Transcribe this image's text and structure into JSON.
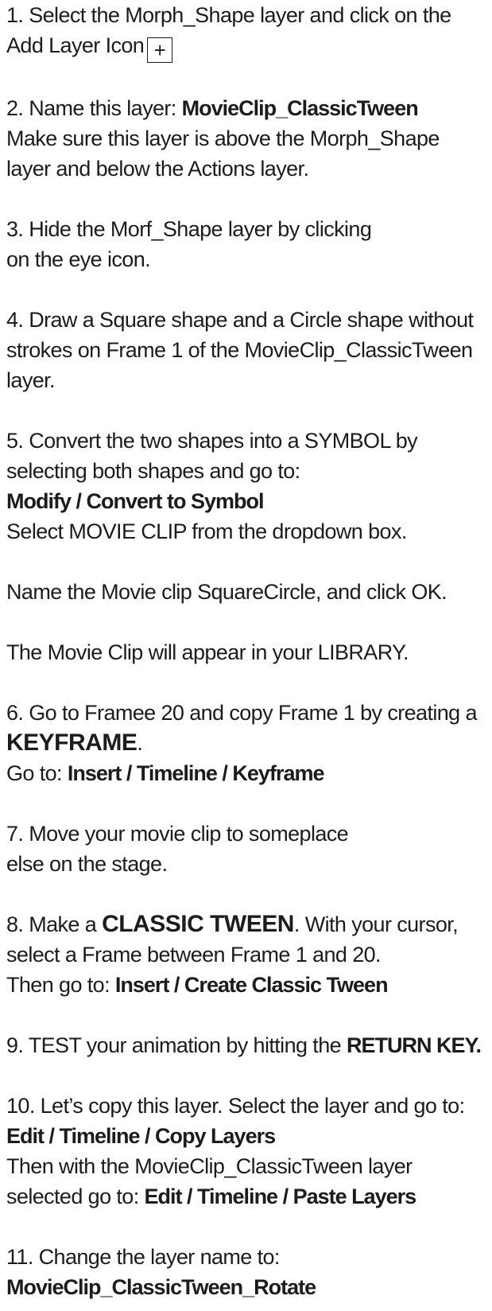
{
  "steps": [
    {
      "lines": [
        "1. Select the  Morph_Shape layer and click on the",
        "Add Layer Icon"
      ],
      "icon": {
        "name": "add-layer-icon",
        "glyph": "+"
      }
    },
    {
      "lines": [
        "2. Name this layer: ",
        "MovieClip_ClassicTween",
        "Make sure this layer is above the Morph_Shape",
        "layer and below the Actions layer."
      ]
    },
    {
      "lines": [
        "3. Hide the Morf_Shape layer by clicking",
        "on the eye icon."
      ]
    },
    {
      "lines": [
        "4. Draw a Square shape and a Circle shape without",
        "strokes on Frame 1 of the MovieClip_ClassicTween",
        "layer."
      ]
    },
    {
      "lines": [
        "5. Convert the two shapes into a SYMBOL by",
        "selecting both shapes and go to:",
        "Modify / Convert to Symbol",
        "Select MOVIE CLIP from the dropdown box."
      ]
    },
    {
      "lines": [
        "Name the Movie clip SquareCircle, and click OK."
      ]
    },
    {
      "lines": [
        "The Movie Clip will appear in your LIBRARY."
      ]
    },
    {
      "lines": [
        "6. Go to Framee 20 and copy Frame 1 by creating a",
        "KEYFRAME",
        ".",
        "Go to: ",
        "Insert / Timeline / Keyframe"
      ]
    },
    {
      "lines": [
        "7. Move your movie clip to someplace",
        "else on the stage."
      ]
    },
    {
      "lines": [
        "8. Make a ",
        "CLASSIC TWEEN",
        ". With your cursor,",
        "select a Frame between Frame 1 and 20.",
        "Then go to: ",
        "Insert / Create Classic Tween"
      ]
    },
    {
      "lines": [
        "9. TEST your animation by hitting the ",
        "RETURN KEY."
      ]
    },
    {
      "lines": [
        "10. Let’s copy this layer. Select the layer and go to:",
        "Edit / Timeline / Copy Layers",
        "Then with the MovieClip_ClassicTween layer",
        "selected  go to: ",
        "Edit / Timeline / Paste Layers"
      ]
    },
    {
      "lines": [
        "11. Change the layer name to:",
        "MovieClip_ClassicTween_Rotate"
      ]
    }
  ]
}
